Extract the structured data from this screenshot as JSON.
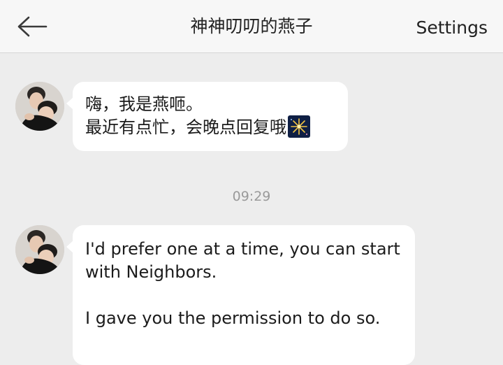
{
  "header": {
    "back_icon": "back-arrow-icon",
    "title": "神神叨叨的燕子",
    "settings_label": "Settings"
  },
  "messages": [
    {
      "sender": "contact",
      "lines": [
        "嗨，我是燕咂。",
        "最近有点忙，会晚点回复哦"
      ],
      "emoji": "fireworks-icon"
    },
    {
      "timestamp": "09:29"
    },
    {
      "sender": "contact",
      "lines": [
        "I'd prefer one at a time, you can start",
        "with Neighbors.",
        "",
        "I gave you the permission to do so."
      ]
    }
  ],
  "colors": {
    "background": "#ededed",
    "header_bg": "#f7f7f7",
    "bubble_bg": "#ffffff",
    "timestamp_text": "#9a9a9a"
  }
}
